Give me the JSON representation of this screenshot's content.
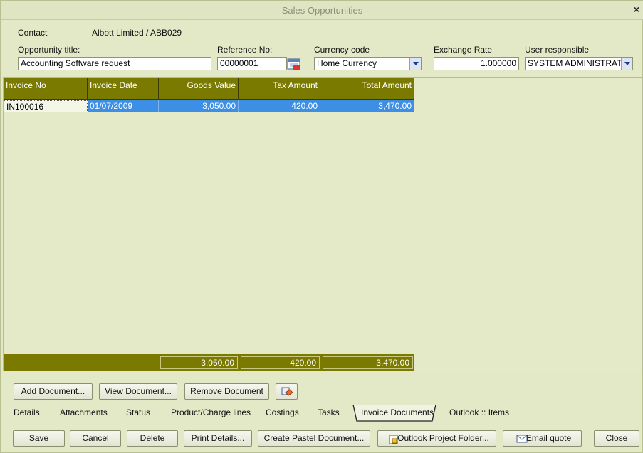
{
  "window": {
    "title": "Sales Opportunities",
    "close_glyph": "×"
  },
  "header": {
    "contact_label": "Contact",
    "contact_value": "Albott Limited / ABB029",
    "opportunity_title_label": "Opportunity title:",
    "opportunity_title_value": "Accounting Software request",
    "reference_label": "Reference No:",
    "reference_value": "00000001",
    "currency_label": "Currency code",
    "currency_value": "Home Currency",
    "exchange_label": "Exchange Rate",
    "exchange_value": "1.000000",
    "user_label": "User responsible",
    "user_value": "SYSTEM ADMINISTRATOI"
  },
  "grid": {
    "columns": [
      "Invoice No",
      "Invoice Date",
      "Goods Value",
      "Tax Amount",
      "Total Amount"
    ],
    "rows": [
      {
        "invoice_no": "IN100016",
        "invoice_date": "01/07/2009",
        "goods_value": "3,050.00",
        "tax_amount": "420.00",
        "total_amount": "3,470.00"
      }
    ],
    "totals": {
      "goods_value": "3,050.00",
      "tax_amount": "420.00",
      "total_amount": "3,470.00"
    }
  },
  "doc_buttons": {
    "add": "Add Document...",
    "view": "View Document...",
    "remove_u": "R",
    "remove_rest": "emove Document"
  },
  "tabs": [
    "Details",
    "Attachments",
    "Status",
    "Product/Charge lines",
    "Costings",
    "Tasks",
    "Invoice Documents",
    "Outlook :: Items"
  ],
  "bottom_buttons": {
    "save_u": "S",
    "save_rest": "ave",
    "cancel_u": "C",
    "cancel_rest": "ancel",
    "delete_u": "D",
    "delete_rest": "elete",
    "print": "Print Details...",
    "create": "Create Pastel Document...",
    "outlook": "Outlook Project Folder...",
    "email": "Email quote",
    "close": "Close"
  },
  "colors": {
    "grid_header": "#7a7a00",
    "selection": "#3d8fe6",
    "background": "#e3e8c6"
  }
}
